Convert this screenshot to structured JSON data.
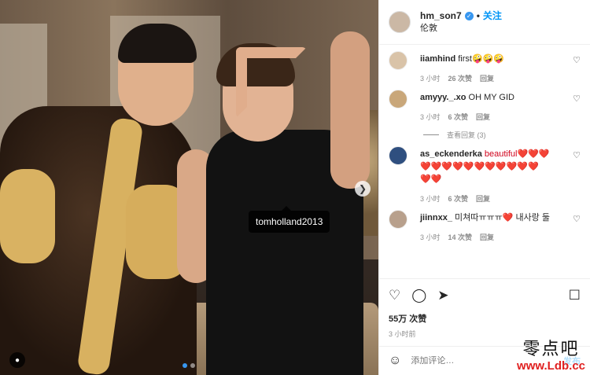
{
  "photo": {
    "tag": "tomholland2013",
    "carousel_dots": 2,
    "active_dot": 0
  },
  "header": {
    "username": "hm_son7",
    "follow": "关注",
    "location": "伦敦"
  },
  "comments": [
    {
      "user": "iiamhind",
      "text": "first🤪🤪🤪",
      "time": "3 小时",
      "likes": "26 次赞",
      "reply": "回复"
    },
    {
      "user": "amyyy._.xo",
      "text": "OH MY GID",
      "time": "3 小时",
      "likes": "6 次赞",
      "reply": "回复",
      "view_replies": "查看回复 (3)"
    },
    {
      "user": "as_eckenderka",
      "text": "beautiful❤️❤️❤️\n❤️❤️❤️❤️❤️❤️❤️❤️❤️❤️❤️\n❤️❤️",
      "time": "3 小时",
      "likes": "6 次赞",
      "reply": "回复"
    },
    {
      "user": "jiinnxx_",
      "text": "미쳐따ㅠㅠㅠ❤️ 내사랑 둘",
      "time": "3 小时",
      "likes": "14 次赞",
      "reply": "回复"
    }
  ],
  "actions": {
    "likes": "55万 次赞",
    "time": "3 小时前"
  },
  "add_comment": {
    "placeholder": "添加评论…",
    "post": "发布"
  },
  "watermark": {
    "line1": "零点吧",
    "line2": "www.Ldb.cc"
  }
}
